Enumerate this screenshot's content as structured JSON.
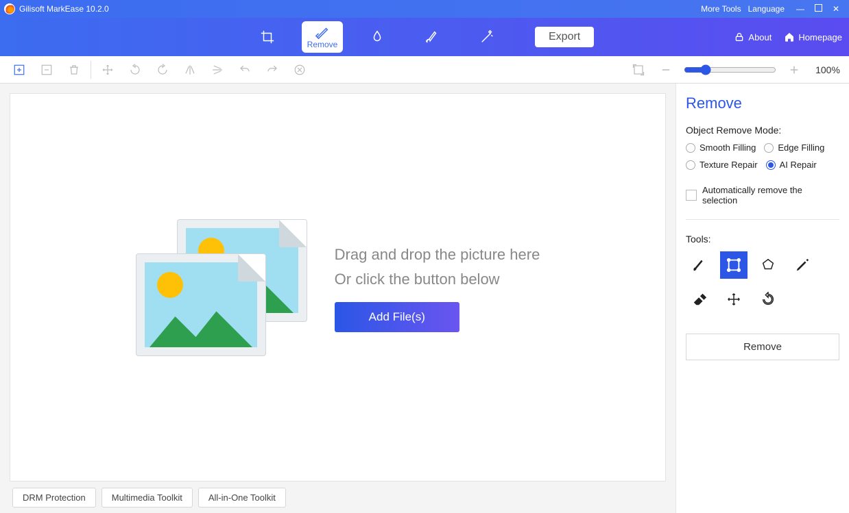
{
  "title": "Gilisoft MarkEase 10.2.0",
  "header_links": {
    "more_tools": "More Tools",
    "language": "Language"
  },
  "ribbon": {
    "crop": "",
    "remove": "Remove",
    "export": "Export",
    "about": "About",
    "homepage": "Homepage"
  },
  "zoom": {
    "value": 20,
    "label": "100%"
  },
  "dropzone": {
    "line1": "Drag and drop the picture here",
    "line2": "Or click the button below",
    "add": "Add File(s)"
  },
  "footer_links": [
    "DRM Protection",
    "Multimedia Toolkit",
    "All-in-One Toolkit"
  ],
  "panel": {
    "title": "Remove",
    "mode_label": "Object Remove Mode:",
    "modes": {
      "smooth": "Smooth Filling",
      "edge": "Edge Filling",
      "texture": "Texture Repair",
      "ai": "AI Repair"
    },
    "auto": "Automatically remove the selection",
    "tools_label": "Tools:",
    "action": "Remove"
  }
}
